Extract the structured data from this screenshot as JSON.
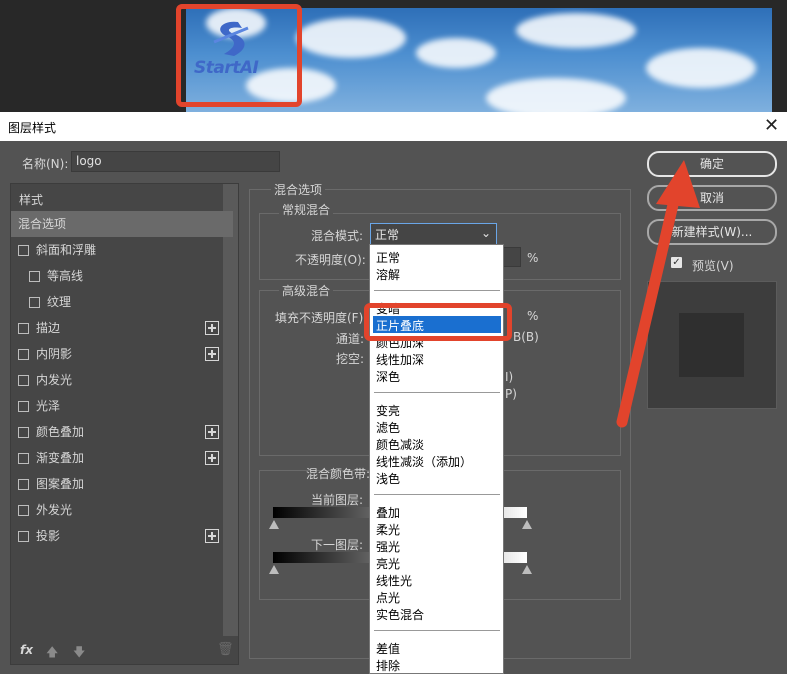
{
  "dialog": {
    "title": "图层样式"
  },
  "name_field": {
    "label": "名称(N):",
    "value": "logo"
  },
  "logo_text": "StartAI",
  "left_panel": {
    "header": "样式",
    "items": [
      {
        "label": "混合选项",
        "checkbox": false,
        "plus": false,
        "selected": true
      },
      {
        "label": "斜面和浮雕",
        "checkbox": true,
        "plus": false
      },
      {
        "label": "等高线",
        "checkbox": true,
        "plus": false,
        "indent": true
      },
      {
        "label": "纹理",
        "checkbox": true,
        "plus": false,
        "indent": true
      },
      {
        "label": "描边",
        "checkbox": true,
        "plus": true
      },
      {
        "label": "内阴影",
        "checkbox": true,
        "plus": true
      },
      {
        "label": "内发光",
        "checkbox": true,
        "plus": false
      },
      {
        "label": "光泽",
        "checkbox": true,
        "plus": false
      },
      {
        "label": "颜色叠加",
        "checkbox": true,
        "plus": true
      },
      {
        "label": "渐变叠加",
        "checkbox": true,
        "plus": true
      },
      {
        "label": "图案叠加",
        "checkbox": true,
        "plus": false
      },
      {
        "label": "外发光",
        "checkbox": true,
        "plus": false
      },
      {
        "label": "投影",
        "checkbox": true,
        "plus": true
      }
    ],
    "footer_fx": "fx"
  },
  "blend_options": {
    "title": "混合选项",
    "general": {
      "title": "常规混合",
      "mode_label": "混合模式:",
      "mode_value": "正常",
      "opacity_label": "不透明度(O):",
      "percent": "%"
    },
    "advanced": {
      "title": "高级混合",
      "fill_label": "填充不透明度(F):",
      "percent": "%",
      "channels_label": "通道:",
      "channels_tail": "B(B)",
      "knockout_label": "挖空:",
      "tail_i": "I)",
      "tail_p": "P)"
    },
    "blend_if": {
      "title": "混合颜色带:",
      "current_layer": "当前图层:",
      "underlying_layer": "下一图层:"
    }
  },
  "dropdown": {
    "groups": [
      [
        "正常",
        "溶解"
      ],
      [
        "变暗",
        "正片叠底",
        "颜色加深",
        "线性加深",
        "深色"
      ],
      [
        "变亮",
        "滤色",
        "颜色减淡",
        "线性减淡（添加）",
        "浅色"
      ],
      [
        "叠加",
        "柔光",
        "强光",
        "亮光",
        "线性光",
        "点光",
        "实色混合"
      ],
      [
        "差值",
        "排除"
      ]
    ],
    "highlighted": "正片叠底"
  },
  "buttons": {
    "ok": "确定",
    "cancel": "取消",
    "new_style": "新建样式(W)...",
    "preview_label": "预览(V)"
  },
  "colors": {
    "annotation_red": "#e2442c",
    "highlight_blue": "#1a6fd0"
  }
}
